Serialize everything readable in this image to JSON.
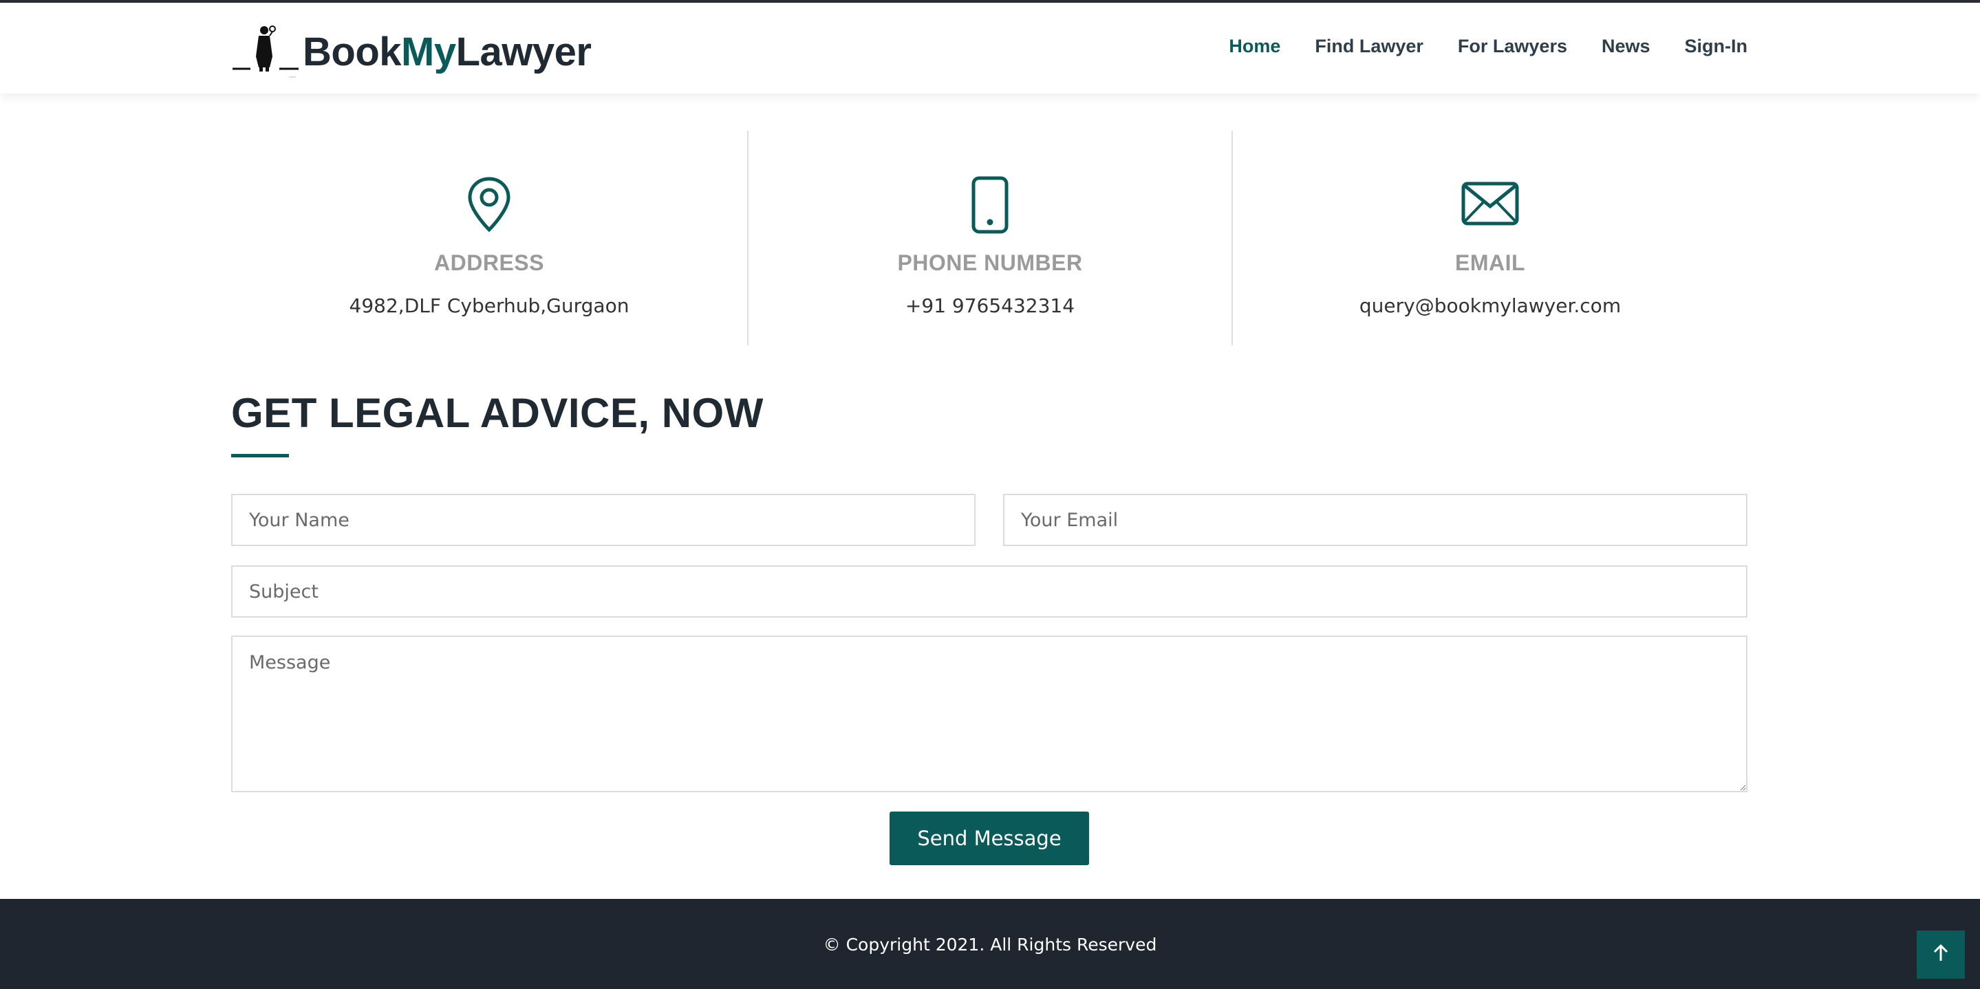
{
  "brand": {
    "name_part1": "Book",
    "name_part2": "My",
    "name_part3": "Lawyer",
    "accent_color": "#0a5a5a",
    "dark_color": "#1f2a33"
  },
  "nav": {
    "items": [
      {
        "label": "Home",
        "active": true
      },
      {
        "label": "Find Lawyer",
        "active": false
      },
      {
        "label": "For Lawyers",
        "active": false
      },
      {
        "label": "News",
        "active": false
      },
      {
        "label": "Sign-In",
        "active": false
      }
    ]
  },
  "contact_info": {
    "address": {
      "icon": "map-pin-icon",
      "title": "ADDRESS",
      "value": "4982,DLF Cyberhub,Gurgaon"
    },
    "phone": {
      "icon": "smartphone-icon",
      "title": "PHONE NUMBER",
      "value": "+91 9765432314"
    },
    "email": {
      "icon": "envelope-icon",
      "title": "EMAIL",
      "value": "query@bookmylawyer.com"
    }
  },
  "form": {
    "heading": "GET LEGAL ADVICE, NOW",
    "name_placeholder": "Your Name",
    "email_placeholder": "Your Email",
    "subject_placeholder": "Subject",
    "message_placeholder": "Message",
    "submit_label": "Send Message"
  },
  "footer": {
    "copyright": "© Copyright 2021. All Rights Reserved",
    "back_to_top_icon": "arrow-up-icon"
  }
}
